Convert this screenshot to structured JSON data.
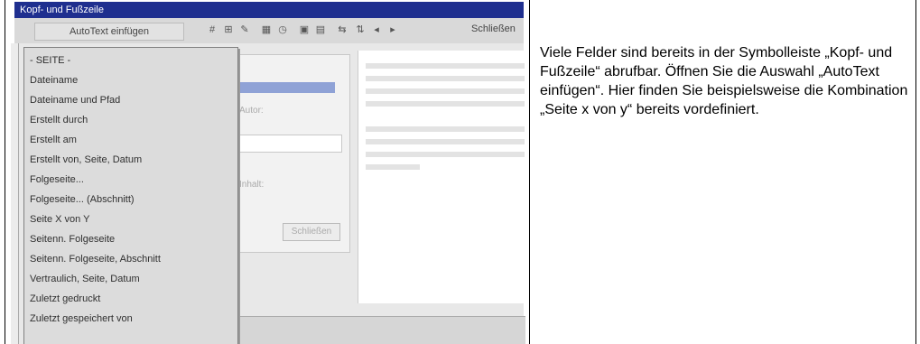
{
  "toolbar": {
    "title": "Kopf- und Fußzeile",
    "autotext_button": "AutoText einfügen",
    "close_label": "Schließen",
    "icons": [
      "page-number-icon",
      "page-count-icon",
      "format-page-number-icon",
      "date-icon",
      "time-icon",
      "page-setup-icon",
      "show-hide-text-icon",
      "same-as-previous-icon",
      "switch-header-footer-icon",
      "show-previous-icon",
      "show-next-icon"
    ]
  },
  "menu": {
    "items": [
      "- SEITE -",
      "Dateiname",
      "Dateiname und Pfad",
      "Erstellt durch",
      "Erstellt am",
      "Erstellt von, Seite, Datum",
      "Folgeseite...",
      "Folgeseite... (Abschnitt)",
      "Seite X von Y",
      "Seitenn. Folgeseite",
      "Seitenn. Folgeseite, Abschnitt",
      "Vertraulich, Seite, Datum",
      "Zuletzt gedruckt",
      "Zuletzt gespeichert von"
    ]
  },
  "dialog": {
    "label": "Autor:",
    "label2": "Inhalt:",
    "button": "Schließen"
  },
  "description": "Viele Felder sind bereits in der Symbolleiste „Kopf- und Fußzeile“ abrufbar. Öffnen Sie die Auswahl „AutoText einfügen“. Hier finden Sie beispielsweise die Kombination „Seite x von y“ bereits vordefiniert."
}
